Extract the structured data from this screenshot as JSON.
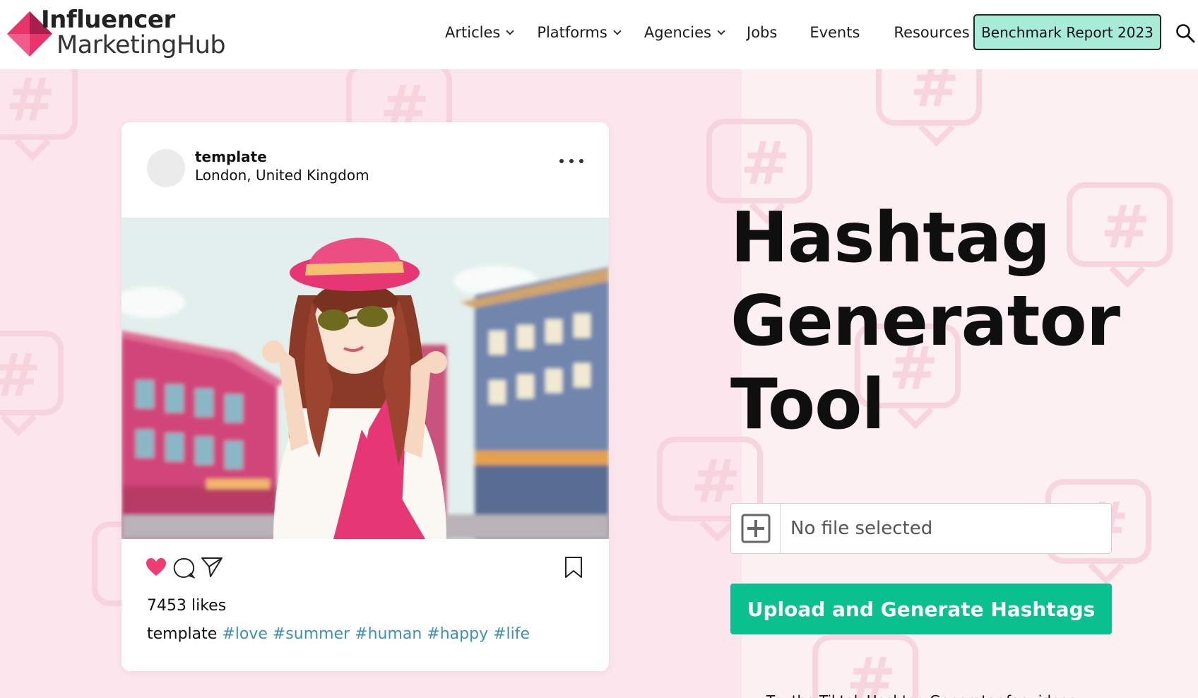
{
  "header": {
    "logo": {
      "line1": "Influencer",
      "line2": "MarketingHub"
    },
    "nav": [
      {
        "label": "Articles",
        "dropdown": true
      },
      {
        "label": "Platforms",
        "dropdown": true
      },
      {
        "label": "Agencies",
        "dropdown": true
      },
      {
        "label": "Jobs",
        "dropdown": false
      },
      {
        "label": "Events",
        "dropdown": false
      },
      {
        "label": "Resources",
        "dropdown": true
      }
    ],
    "cta_label": "Benchmark Report 2023",
    "search_icon": "search-icon"
  },
  "post": {
    "username": "template",
    "location": "London, United Kingdom",
    "likes": "7453 likes",
    "caption_user": "template",
    "caption_tags": "#love #summer #human #happy #life",
    "icons": [
      "heart-icon",
      "comment-icon",
      "share-icon",
      "bookmark-icon",
      "more-icon"
    ]
  },
  "hero": {
    "title_line1": "Hashtag",
    "title_line2": "Generator",
    "title_line3": "Tool",
    "file_status": "No file selected",
    "upload_label": "Upload and Generate Hashtags",
    "tiktok_link": "Try the Tiktok Hashtag Generator for videos"
  },
  "colors": {
    "accent_green": "#09c08e",
    "cta_mint": "#a7ecd7",
    "hero_pink": "#fce5ec",
    "logo_pink": "#e8336b",
    "hashtag_blue": "#3e8fb8",
    "heart_pink": "#ef3d73"
  }
}
